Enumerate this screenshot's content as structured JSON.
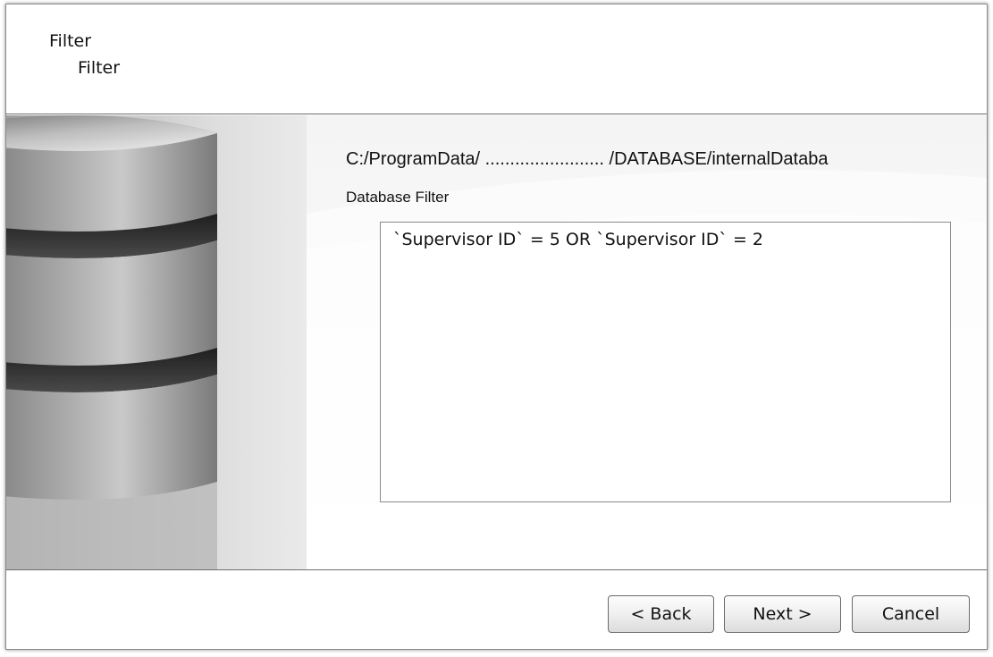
{
  "header": {
    "title": "Filter",
    "subtitle": "Filter"
  },
  "main": {
    "path": "C:/ProgramData/ ........................ /DATABASE/internalDataba",
    "filter_label": "Database Filter",
    "filter_value": "`Supervisor ID` = 5 OR `Supervisor ID` = 2"
  },
  "footer": {
    "back_label": "< Back",
    "next_label": "Next >",
    "cancel_label": "Cancel"
  },
  "icons": {
    "database_image": "database-cylinders-icon"
  }
}
